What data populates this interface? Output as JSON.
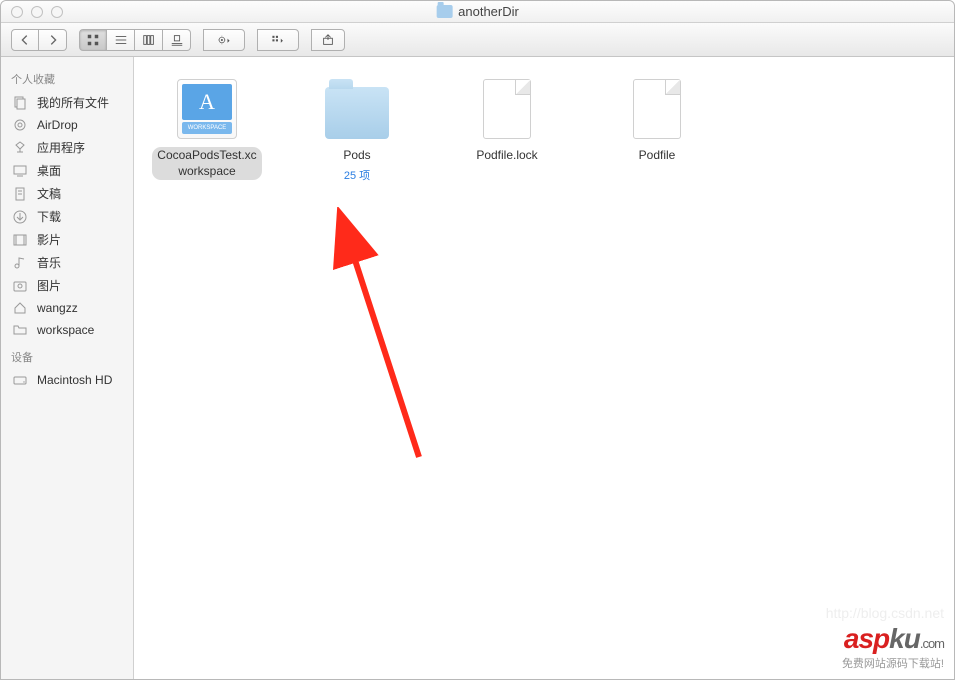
{
  "window": {
    "title": "anotherDir"
  },
  "sidebar": {
    "section_favorites": "个人收藏",
    "section_devices": "设备",
    "favorites": [
      {
        "label": "我的所有文件",
        "icon": "all-files"
      },
      {
        "label": "AirDrop",
        "icon": "airdrop"
      },
      {
        "label": "应用程序",
        "icon": "apps"
      },
      {
        "label": "桌面",
        "icon": "desktop"
      },
      {
        "label": "文稿",
        "icon": "documents"
      },
      {
        "label": "下载",
        "icon": "downloads"
      },
      {
        "label": "影片",
        "icon": "movies"
      },
      {
        "label": "音乐",
        "icon": "music"
      },
      {
        "label": "图片",
        "icon": "pictures"
      },
      {
        "label": "wangzz",
        "icon": "home"
      },
      {
        "label": "workspace",
        "icon": "folder"
      }
    ],
    "devices": [
      {
        "label": "Macintosh HD",
        "icon": "disk"
      }
    ]
  },
  "items": [
    {
      "name": "CocoaPodsTest.xcworkspace",
      "type": "workspace",
      "selected": true,
      "sub": ""
    },
    {
      "name": "Pods",
      "type": "folder",
      "selected": false,
      "sub": "25 项"
    },
    {
      "name": "Podfile.lock",
      "type": "file",
      "selected": false,
      "sub": ""
    },
    {
      "name": "Podfile",
      "type": "file",
      "selected": false,
      "sub": ""
    }
  ],
  "watermark": {
    "url": "http://blog.csdn.net",
    "brand_red": "asp",
    "brand_gray": "ku",
    "brand_suffix": ".com",
    "tagline": "免费网站源码下载站!"
  }
}
